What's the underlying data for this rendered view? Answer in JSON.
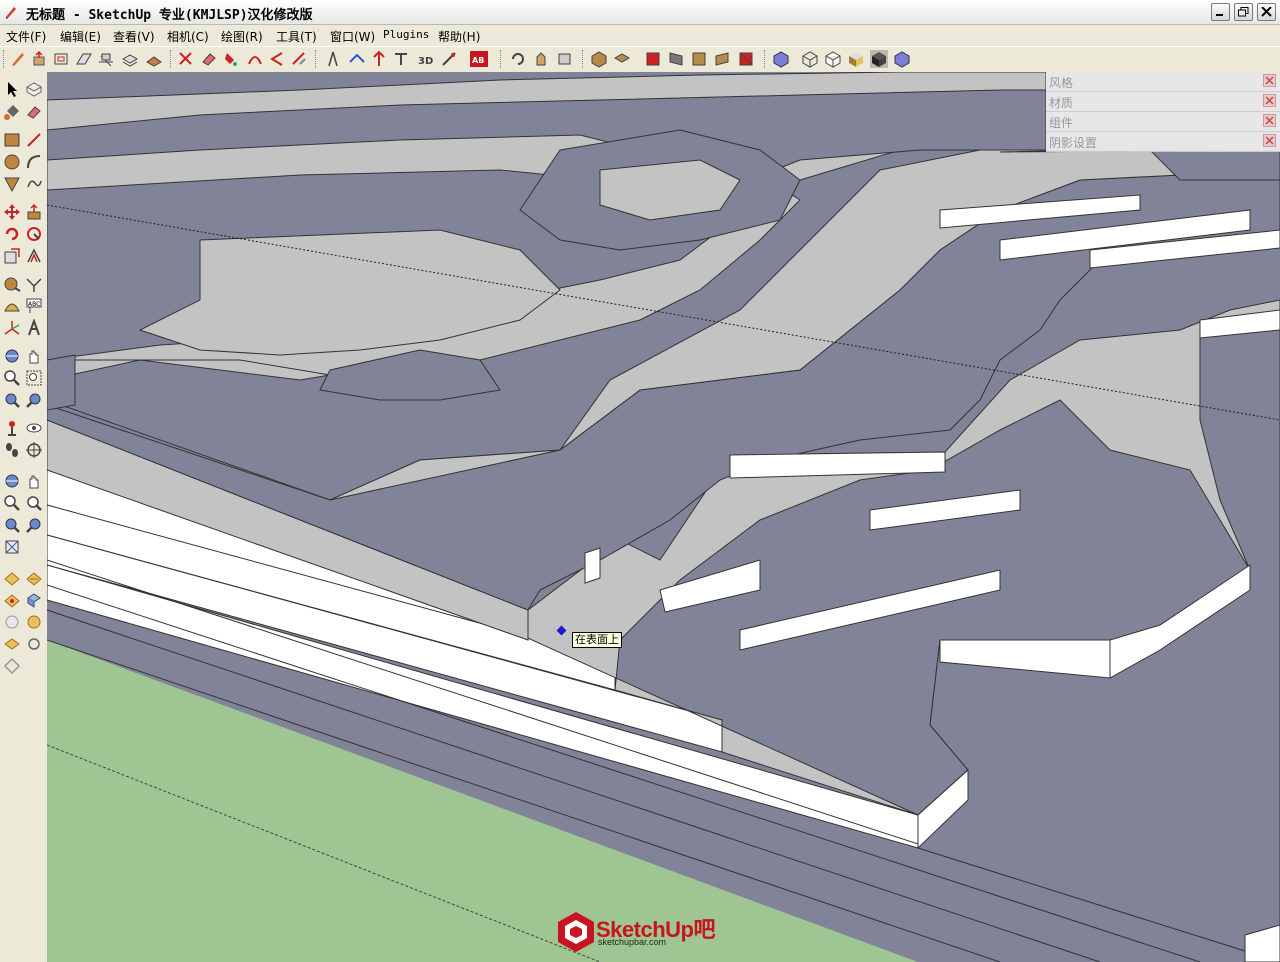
{
  "window": {
    "title": "无标题 - SketchUp 专业(KMJLSP)汉化修改版"
  },
  "menu": [
    {
      "label": "文件(F)"
    },
    {
      "label": "编辑(E)"
    },
    {
      "label": "查看(V)"
    },
    {
      "label": "相机(C)"
    },
    {
      "label": "绘图(R)"
    },
    {
      "label": "工具(T)"
    },
    {
      "label": "窗口(W)"
    },
    {
      "label": "Plugins"
    },
    {
      "label": "帮助(H)"
    }
  ],
  "tray": [
    {
      "label": "风格"
    },
    {
      "label": "材质"
    },
    {
      "label": "组件"
    },
    {
      "label": "阴影设置"
    }
  ],
  "viewport": {
    "tooltip": "在表面上"
  },
  "watermark": {
    "brand": "SketchUp吧",
    "url": "sketchupbar.com"
  },
  "colors": {
    "terrain_top": "#c3c3c3",
    "terrain_water": "#818498",
    "terrain_side": "#ffffff",
    "ground": "#9fc592",
    "accent_red": "#c8141e"
  }
}
